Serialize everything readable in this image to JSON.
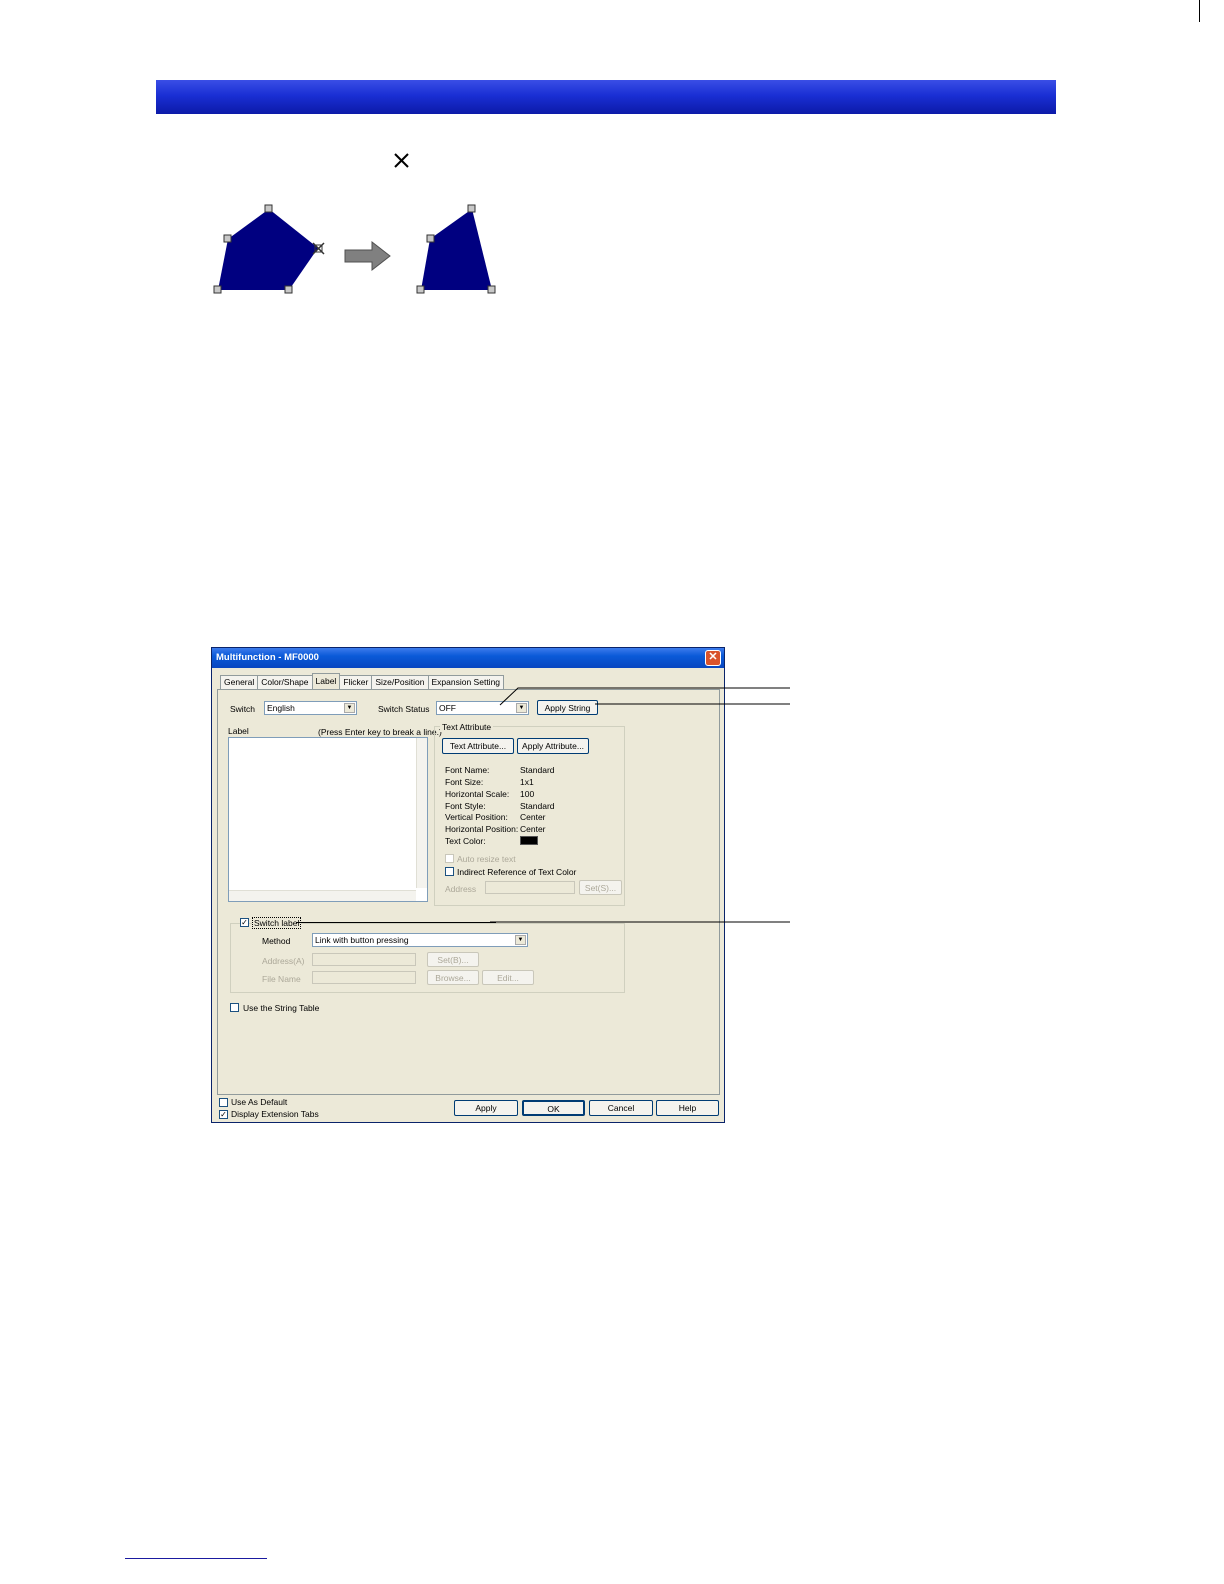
{
  "dialog": {
    "title": "Multifunction - MF0000",
    "close_glyph": "✕",
    "tabs": [
      "General",
      "Color/Shape",
      "Label",
      "Flicker",
      "Size/Position",
      "Expansion Setting"
    ],
    "switch_label": "Switch",
    "switch_value": "English",
    "switch_status_label": "Switch Status",
    "switch_status_value": "OFF",
    "apply_string_button": "Apply String",
    "label_heading": "Label",
    "label_hint": "(Press Enter key to break a line.)",
    "text_attribute_group": "Text Attribute",
    "text_attribute_button": "Text Attribute...",
    "apply_attribute_button": "Apply Attribute...",
    "attributes": [
      {
        "key": "Font Name:",
        "value": "Standard"
      },
      {
        "key": "Font Size:",
        "value": "1x1"
      },
      {
        "key": "Horizontal Scale:",
        "value": "100"
      },
      {
        "key": "Font Style:",
        "value": "Standard"
      },
      {
        "key": "Vertical Position:",
        "value": "Center"
      },
      {
        "key": "Horizontal Position:",
        "value": "Center"
      },
      {
        "key": "Text Color:",
        "value": ""
      }
    ],
    "text_color": "#000000",
    "auto_resize_text": "Auto resize text",
    "indirect_reference": "Indirect Reference of Text Color",
    "address_label": "Address",
    "set_button": "Set(S)...",
    "switch_label_check": "Switch label",
    "method_label": "Method",
    "method_value": "Link with button pressing",
    "address_a_label": "Address(A)",
    "set_b_button": "Set(B)...",
    "file_name_label": "File Name",
    "browse_button": "Browse...",
    "edit_button": "Edit...",
    "use_string_table": "Use the String Table",
    "use_as_default": "Use As Default",
    "display_extension_tabs": "Display Extension Tabs",
    "apply_button": "Apply",
    "ok_button": "OK",
    "cancel_button": "Cancel",
    "help_button": "Help"
  },
  "figure": {
    "delete_cursor_icon": "x-cursor-icon",
    "polygon_color": "#000080",
    "arrow_color": "#808080"
  },
  "header_colors": [
    "#3a4ee6",
    "#0c1aa8"
  ]
}
